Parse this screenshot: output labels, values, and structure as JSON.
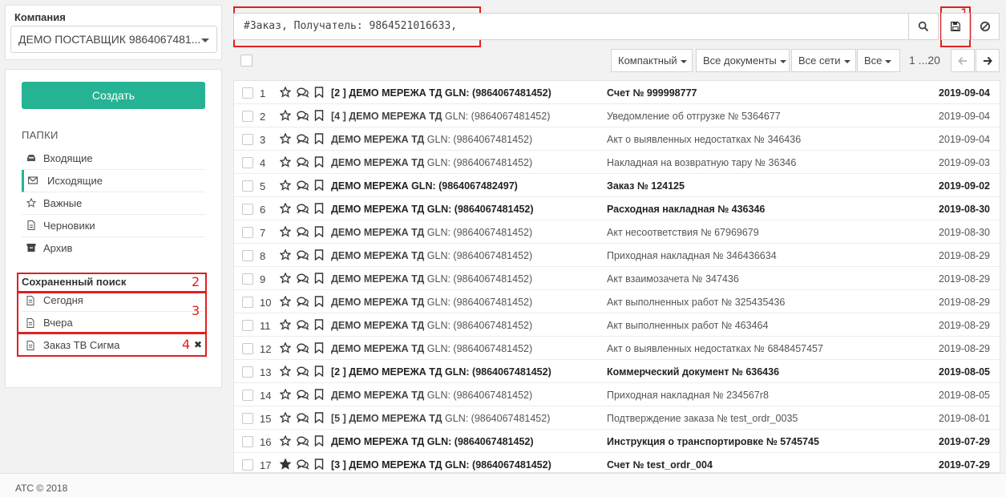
{
  "company": {
    "label": "Компания",
    "selected": "ДЕМО ПОСТАВЩИК 9864067481..."
  },
  "nav": {
    "create_label": "Создать",
    "folders_title": "ПАПКИ",
    "folders": [
      {
        "label": "Входящие",
        "icon": "inbox-icon"
      },
      {
        "label": "Исходящие",
        "icon": "envelope-icon"
      },
      {
        "label": "Важные",
        "icon": "star-icon"
      },
      {
        "label": "Черновики",
        "icon": "file-icon"
      },
      {
        "label": "Архив",
        "icon": "archive-icon"
      }
    ],
    "active_folder": "Исходящие",
    "saved_title": "Сохраненный поиск",
    "saved": [
      {
        "label": "Сегодня"
      },
      {
        "label": "Вчера"
      },
      {
        "label": "Заказ ТВ Сигма",
        "remove": "✖"
      }
    ]
  },
  "search": {
    "query": "#Заказ, Получатель: 9864521016633,"
  },
  "annotations": [
    "1",
    "2",
    "3",
    "4"
  ],
  "toolbar": {
    "view_label": "Компактный",
    "docs_label": "Все документы",
    "networks_label": "Все сети",
    "all_label": "Все",
    "pager": "1 ...20"
  },
  "rows": [
    {
      "num": "1",
      "bold": true,
      "starred": false,
      "prefix": "[2 ] ",
      "name": "ДЕМО МЕРЕЖА ТД",
      "gln": " GLN: (9864067481452)",
      "title": "Счет № 999998777",
      "date": "2019-09-04"
    },
    {
      "num": "2",
      "bold": false,
      "starred": false,
      "prefix": "[4 ] ",
      "name": "ДЕМО МЕРЕЖА ТД",
      "gln": " GLN: (9864067481452)",
      "title": "Уведомление об отгрузке № 5364677",
      "date": "2019-09-04"
    },
    {
      "num": "3",
      "bold": false,
      "starred": false,
      "prefix": "",
      "name": "ДЕМО МЕРЕЖА ТД",
      "gln": " GLN: (9864067481452)",
      "title": "Акт о выявленных недостатках № 346436",
      "date": "2019-09-04"
    },
    {
      "num": "4",
      "bold": false,
      "starred": false,
      "prefix": "",
      "name": "ДЕМО МЕРЕЖА ТД",
      "gln": " GLN: (9864067481452)",
      "title": "Накладная на возвратную тару № 36346",
      "date": "2019-09-03"
    },
    {
      "num": "5",
      "bold": true,
      "starred": false,
      "prefix": "",
      "name": "ДЕМО МЕРЕЖА",
      "gln": " GLN: (9864067482497)",
      "title": "Заказ № 124125",
      "date": "2019-09-02"
    },
    {
      "num": "6",
      "bold": true,
      "starred": false,
      "prefix": "",
      "name": "ДЕМО МЕРЕЖА ТД",
      "gln": " GLN: (9864067481452)",
      "title": "Расходная накладная № 436346",
      "date": "2019-08-30"
    },
    {
      "num": "7",
      "bold": false,
      "starred": false,
      "prefix": "",
      "name": "ДЕМО МЕРЕЖА ТД",
      "gln": " GLN: (9864067481452)",
      "title": "Акт несоответствия № 67969679",
      "date": "2019-08-30"
    },
    {
      "num": "8",
      "bold": false,
      "starred": false,
      "prefix": "",
      "name": "ДЕМО МЕРЕЖА ТД",
      "gln": " GLN: (9864067481452)",
      "title": "Приходная накладная № 346436634",
      "date": "2019-08-29"
    },
    {
      "num": "9",
      "bold": false,
      "starred": false,
      "prefix": "",
      "name": "ДЕМО МЕРЕЖА ТД",
      "gln": " GLN: (9864067481452)",
      "title": "Акт взаимозачета № 347436",
      "date": "2019-08-29"
    },
    {
      "num": "10",
      "bold": false,
      "starred": false,
      "prefix": "",
      "name": "ДЕМО МЕРЕЖА ТД",
      "gln": " GLN: (9864067481452)",
      "title": "Акт выполненных работ № 325435436",
      "date": "2019-08-29"
    },
    {
      "num": "11",
      "bold": false,
      "starred": false,
      "prefix": "",
      "name": "ДЕМО МЕРЕЖА ТД",
      "gln": " GLN: (9864067481452)",
      "title": "Акт выполненных работ № 463464",
      "date": "2019-08-29"
    },
    {
      "num": "12",
      "bold": false,
      "starred": false,
      "prefix": "",
      "name": "ДЕМО МЕРЕЖА ТД",
      "gln": " GLN: (9864067481452)",
      "title": "Акт о выявленных недостатках № 6848457457",
      "date": "2019-08-29"
    },
    {
      "num": "13",
      "bold": true,
      "starred": false,
      "prefix": "[2 ] ",
      "name": "ДЕМО МЕРЕЖА ТД",
      "gln": " GLN: (9864067481452)",
      "title": "Коммерческий документ № 636436",
      "date": "2019-08-05"
    },
    {
      "num": "14",
      "bold": false,
      "starred": false,
      "prefix": "",
      "name": "ДЕМО МЕРЕЖА ТД",
      "gln": " GLN: (9864067481452)",
      "title": "Приходная накладная № 234567r8",
      "date": "2019-08-05"
    },
    {
      "num": "15",
      "bold": false,
      "starred": false,
      "prefix": "[5 ] ",
      "name": "ДЕМО МЕРЕЖА ТД",
      "gln": " GLN: (9864067481452)",
      "title": "Подтверждение заказа № test_ordr_0035",
      "date": "2019-08-01"
    },
    {
      "num": "16",
      "bold": true,
      "starred": false,
      "prefix": "",
      "name": "ДЕМО МЕРЕЖА ТД",
      "gln": " GLN: (9864067481452)",
      "title": "Инструкция о транспортировке № 5745745",
      "date": "2019-07-29"
    },
    {
      "num": "17",
      "bold": true,
      "starred": true,
      "prefix": "[3 ] ",
      "name": "ДЕМО МЕРЕЖА ТД",
      "gln": " GLN: (9864067481452)",
      "title": "Счет № test_ordr_004",
      "date": "2019-07-29"
    }
  ],
  "footer": {
    "text": "АТС © 2018"
  },
  "colors": {
    "accent": "#26b394",
    "annotation": "#e02020"
  }
}
